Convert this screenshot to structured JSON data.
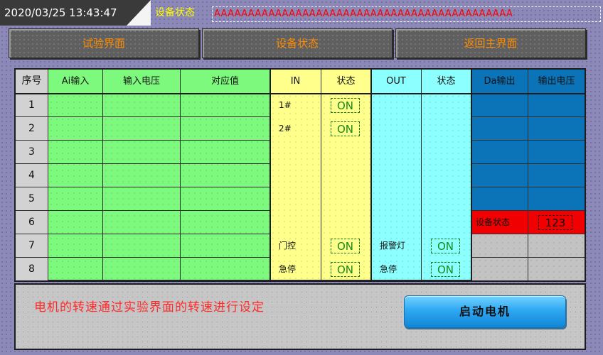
{
  "topbar": {
    "datetime": "2020/03/25 13:43:47",
    "status_label": "设备状态",
    "status_message": "AAAAAAAAAAAAAAAAAAAAAAAAAAAAAAAAAAAAAAAAAAAA"
  },
  "nav": {
    "test_screen": "试验界面",
    "device_status": "设备状态",
    "back_main": "返回主界面"
  },
  "table": {
    "headers": {
      "seq": "序号",
      "ai_input": "Ai输入",
      "input_voltage": "输入电压",
      "mapped_value": "对应值",
      "in": "IN",
      "in_state": "状态",
      "out": "OUT",
      "out_state": "状态",
      "da_output": "Da输出",
      "output_voltage": "输出电压"
    },
    "rows": [
      "1",
      "2",
      "3",
      "4",
      "5",
      "6",
      "7",
      "8"
    ],
    "inputs": {
      "in1_label": "1#",
      "in1_state": "ON",
      "in2_label": "2#",
      "in2_state": "ON",
      "door_label": "门控",
      "door_state": "ON",
      "estop_in_label": "急停",
      "estop_in_state": "ON"
    },
    "outputs": {
      "alarm_label": "报警灯",
      "alarm_state": "ON",
      "estop_out_label": "急停",
      "estop_out_state": "ON"
    },
    "device_status": {
      "label": "设备状态",
      "value": "123"
    }
  },
  "panel": {
    "hint": "电机的转速通过实验界面的转速进行设定",
    "start_button": "启动电机"
  },
  "colors": {
    "background": "#8c88b8",
    "analog": "#7dfa7d",
    "digital_in": "#ffff8c",
    "digital_out": "#8cffff",
    "da_output": "#0b74b9",
    "alert": "#f00000",
    "nav_text": "#ff8c00"
  }
}
